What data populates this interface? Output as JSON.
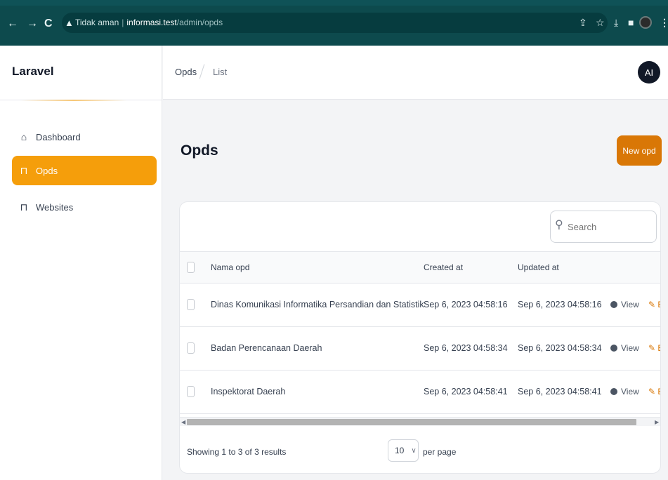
{
  "browser": {
    "security_label": "Tidak aman",
    "url_host": "informasi.test",
    "url_path": "/admin/opds"
  },
  "sidebar": {
    "brand": "Laravel",
    "items": [
      {
        "label": "Dashboard",
        "icon": "home-icon"
      },
      {
        "label": "Opds",
        "icon": "jar-icon",
        "active": true
      },
      {
        "label": "Websites",
        "icon": "jar-icon"
      }
    ]
  },
  "header": {
    "breadcrumbs": [
      "Opds",
      "List"
    ],
    "avatar_initials": "AI"
  },
  "main": {
    "title": "Opds",
    "new_button": "New opd",
    "search_placeholder": "Search",
    "columns": [
      "Nama opd",
      "Created at",
      "Updated at"
    ],
    "rows": [
      {
        "name": "Dinas Komunikasi Informatika Persandian dan Statistik",
        "created": "Sep 6, 2023 04:58:16",
        "updated": "Sep 6, 2023 04:58:16",
        "view": "View",
        "edit": "E"
      },
      {
        "name": "Badan Perencanaan Daerah",
        "created": "Sep 6, 2023 04:58:34",
        "updated": "Sep 6, 2023 04:58:34",
        "view": "View",
        "edit": "E"
      },
      {
        "name": "Inspektorat Daerah",
        "created": "Sep 6, 2023 04:58:41",
        "updated": "Sep 6, 2023 04:58:41",
        "view": "View",
        "edit": "E"
      }
    ],
    "showing": "Showing 1 to 3 of 3 results",
    "per_page_value": "10",
    "per_page_label": "per page"
  },
  "colors": {
    "accent": "#f59e0b",
    "button": "#d97706",
    "browser_bar": "#0d4a4d"
  }
}
